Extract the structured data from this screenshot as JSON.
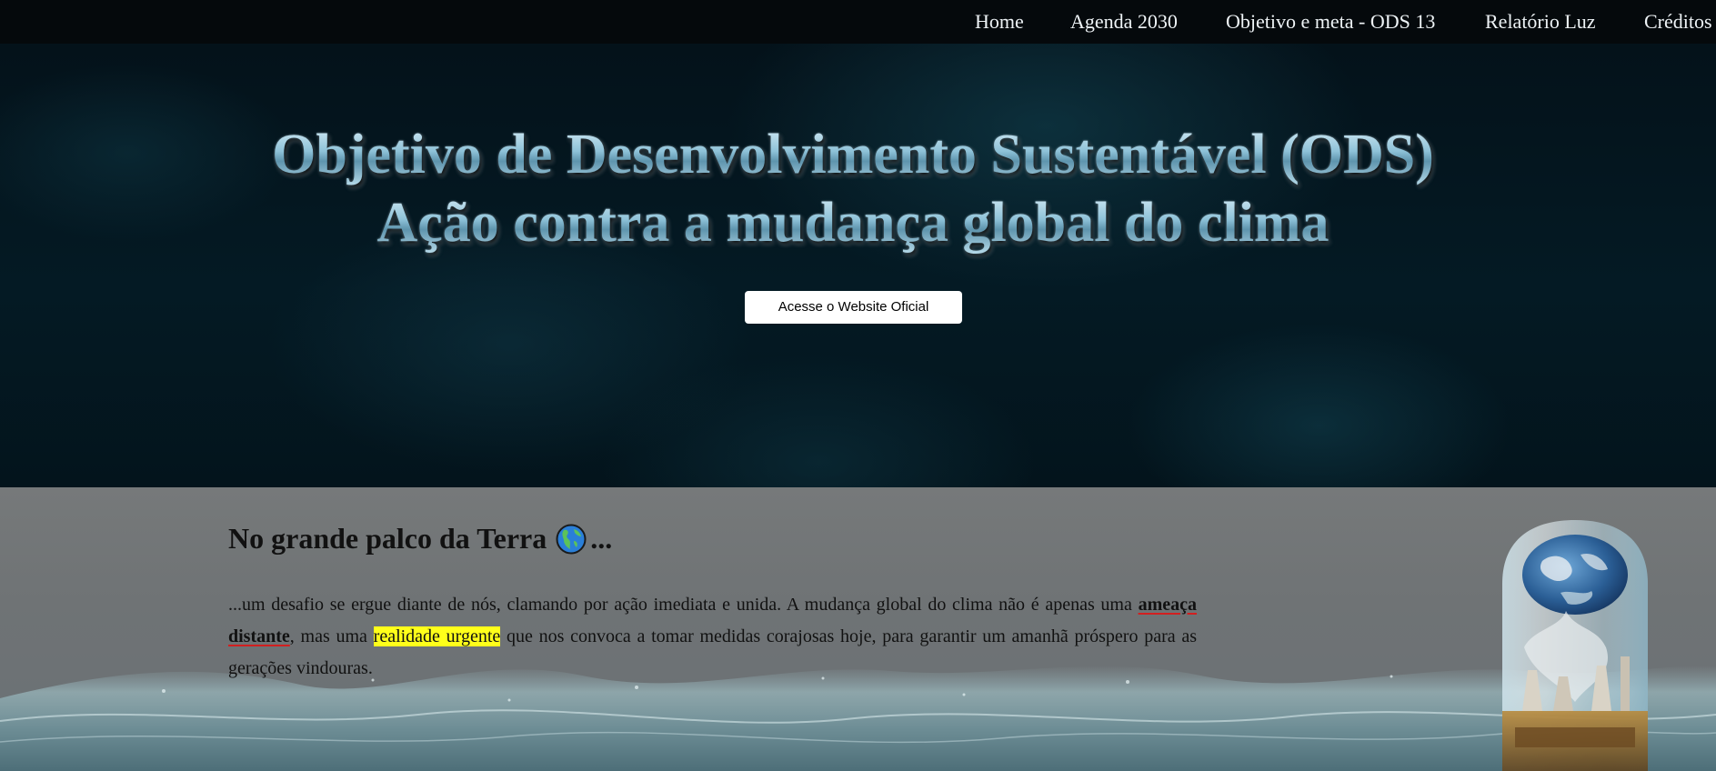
{
  "nav": {
    "items": [
      {
        "label": "Home"
      },
      {
        "label": "Agenda 2030"
      },
      {
        "label": "Objetivo e meta - ODS 13"
      },
      {
        "label": "Relatório Luz"
      },
      {
        "label": "Créditos"
      }
    ]
  },
  "hero": {
    "title_line1": "Objetivo de Desenvolvimento Sustentável (ODS)",
    "title_line2": "Ação contra a mudança global do clima",
    "button_label": "Acesse o Website Oficial"
  },
  "section": {
    "heading_pre": "No grande palco da Terra",
    "heading_post": "...",
    "paragraph": {
      "part1": "...um desafio se ergue diante de nós, clamando por ação imediata e unida. A mudança global do clima não é apenas uma ",
      "emphasis": "ameaça distante",
      "part2": ", mas uma ",
      "highlight": "realidade urgente",
      "part3": " que nos convoca a tomar medidas corajosas hoje, para garantir um amanhã próspero para as gerações vindouras."
    }
  },
  "colors": {
    "nav_bg": "#05090c",
    "highlight": "#ffff1a",
    "underline": "#d21f1f"
  },
  "icons": {
    "heading_icon": "globe-americas-icon",
    "illustration": "earth-in-glass-jar-with-factory"
  }
}
